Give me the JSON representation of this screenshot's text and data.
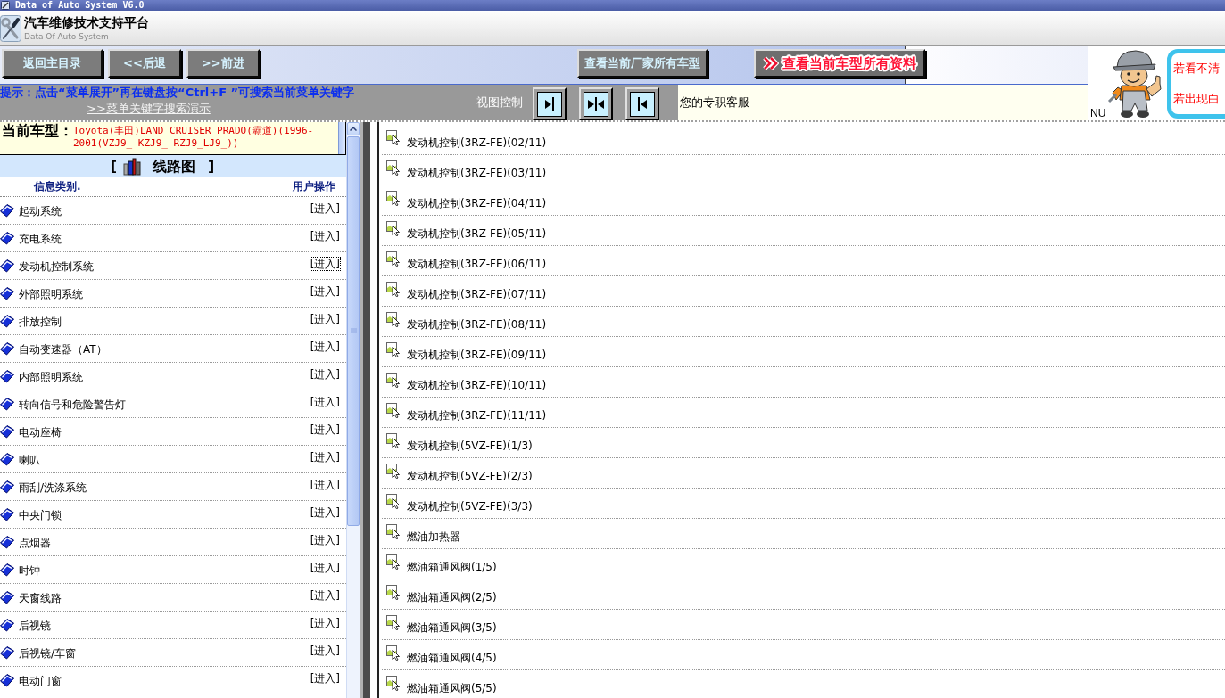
{
  "window": {
    "title": "Data of Auto System V6.0"
  },
  "header": {
    "title": "汽车维修技术支持平台",
    "subtitle": "Data Of Auto System"
  },
  "toolbar": {
    "buttons": [
      {
        "label": "返回主目录",
        "kind": "nav"
      },
      {
        "label": "<<后退",
        "kind": "nav"
      },
      {
        "label": ">>前进",
        "kind": "nav"
      },
      {
        "label": "查看当前厂家所有车型",
        "kind": "maker"
      },
      {
        "label": "查看当前车型所有资料",
        "kind": "highlight"
      }
    ]
  },
  "hint": {
    "text": "提示：点击“菜单展开”再在键盘按“Ctrl+F ”可搜索当前菜单关键字",
    "link": ">>菜单关键字搜索演示"
  },
  "view_control": {
    "label": "视图控制",
    "buttons": [
      {
        "kind": "right"
      },
      {
        "kind": "both"
      },
      {
        "kind": "left"
      }
    ]
  },
  "support": {
    "label": "您的专职客服",
    "partial_text": "NU",
    "notes": [
      "若看不清",
      "若出现白"
    ]
  },
  "model": {
    "label": "当前车型：",
    "value": "Toyota(丰田)LAND CRUISER PRADO(霸道)(1996-2001(VZJ9_ KZJ9_ RZJ9_LJ9_))"
  },
  "section": {
    "open": "[",
    "title": "线路图",
    "close": "]"
  },
  "categories": {
    "columns": [
      "信息类别.",
      "用户操作"
    ],
    "items": [
      {
        "name": "起动系统",
        "action": "[进入]",
        "focused": false
      },
      {
        "name": "充电系统",
        "action": "[进入]",
        "focused": false
      },
      {
        "name": "发动机控制系统",
        "action": "[进入]",
        "focused": true
      },
      {
        "name": "外部照明系统",
        "action": "[进入]",
        "focused": false
      },
      {
        "name": "排放控制",
        "action": "[进入]",
        "focused": false
      },
      {
        "name": "自动变速器（AT）",
        "action": "[进入]",
        "focused": false
      },
      {
        "name": "内部照明系统",
        "action": "[进入]",
        "focused": false
      },
      {
        "name": "转向信号和危险警告灯",
        "action": "[进入]",
        "focused": false
      },
      {
        "name": "电动座椅",
        "action": "[进入]",
        "focused": false
      },
      {
        "name": "喇叭",
        "action": "[进入]",
        "focused": false
      },
      {
        "name": "雨刮/洗涤系统",
        "action": "[进入]",
        "focused": false
      },
      {
        "name": "中央门锁",
        "action": "[进入]",
        "focused": false
      },
      {
        "name": "点烟器",
        "action": "[进入]",
        "focused": false
      },
      {
        "name": "时钟",
        "action": "[进入]",
        "focused": false
      },
      {
        "name": "天窗线路",
        "action": "[进入]",
        "focused": false
      },
      {
        "name": "后视镜",
        "action": "[进入]",
        "focused": false
      },
      {
        "name": "后视镜/车窗",
        "action": "[进入]",
        "focused": false
      },
      {
        "name": "电动门窗",
        "action": "[进入]",
        "focused": false
      }
    ]
  },
  "diagrams": {
    "items": [
      {
        "name": "发动机控制(3RZ-FE)(02/11)"
      },
      {
        "name": "发动机控制(3RZ-FE)(03/11)"
      },
      {
        "name": "发动机控制(3RZ-FE)(04/11)"
      },
      {
        "name": "发动机控制(3RZ-FE)(05/11)"
      },
      {
        "name": "发动机控制(3RZ-FE)(06/11)"
      },
      {
        "name": "发动机控制(3RZ-FE)(07/11)"
      },
      {
        "name": "发动机控制(3RZ-FE)(08/11)"
      },
      {
        "name": "发动机控制(3RZ-FE)(09/11)"
      },
      {
        "name": "发动机控制(3RZ-FE)(10/11)"
      },
      {
        "name": "发动机控制(3RZ-FE)(11/11)"
      },
      {
        "name": "发动机控制(5VZ-FE)(1/3)"
      },
      {
        "name": "发动机控制(5VZ-FE)(2/3)"
      },
      {
        "name": "发动机控制(5VZ-FE)(3/3)"
      },
      {
        "name": "燃油加热器"
      },
      {
        "name": "燃油箱通风阀(1/5)"
      },
      {
        "name": "燃油箱通风阀(2/5)"
      },
      {
        "name": "燃油箱通风阀(3/5)"
      },
      {
        "name": "燃油箱通风阀(4/5)"
      },
      {
        "name": "燃油箱通风阀(5/5)"
      }
    ]
  }
}
